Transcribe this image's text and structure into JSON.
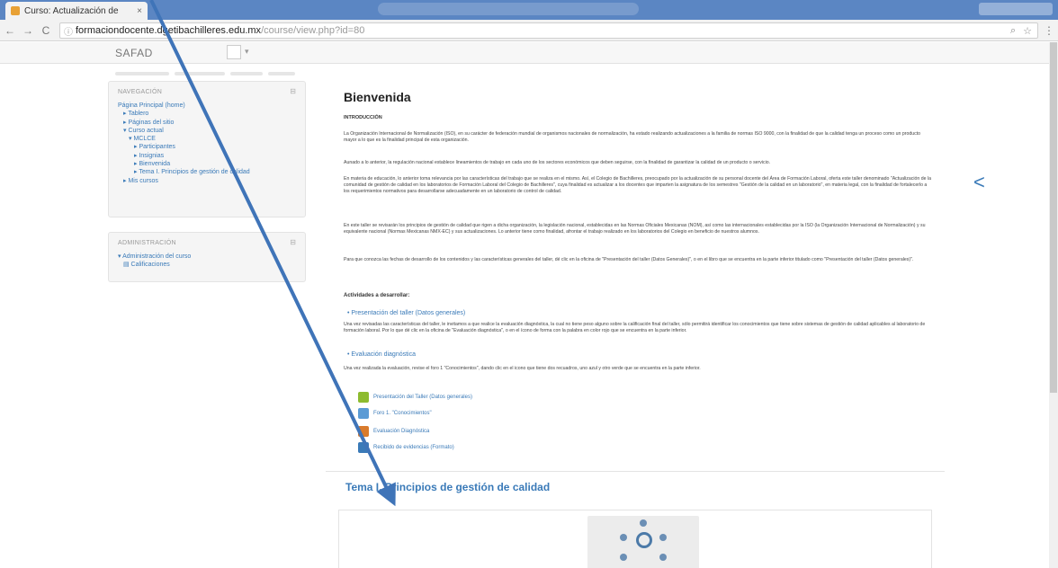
{
  "browser": {
    "tab_title": "Curso: Actualización de",
    "tab_close": "×",
    "url_host": "formaciondocente.dgetibachilleres.edu.mx",
    "url_path": "/course/view.php?id=80",
    "back": "←",
    "forward": "→",
    "reload": "C",
    "menu": "⋮"
  },
  "moodle": {
    "brand": "SAFAD",
    "user": "",
    "user_caret": "▾"
  },
  "nav_block": {
    "title": "NAVEGACIÓN",
    "items": [
      {
        "label": "Página Principal (home)",
        "level": 0
      },
      {
        "label": "▸ Tablero",
        "level": 1
      },
      {
        "label": "▸ Páginas del sitio",
        "level": 1
      },
      {
        "label": "▾ Curso actual",
        "level": 1
      },
      {
        "label": "▾ MCLCE",
        "level": 2
      },
      {
        "label": "▸ Participantes",
        "level": 3
      },
      {
        "label": "▸ Insignias",
        "level": 3
      },
      {
        "label": "▸ Bienvenida",
        "level": 3
      },
      {
        "label": "▸ Tema I. Principios de gestión de calidad",
        "level": 3
      },
      {
        "label": "▸ Mis cursos",
        "level": 1
      }
    ]
  },
  "admin_block": {
    "title": "ADMINISTRACIÓN",
    "items": [
      {
        "label": "▾ Administración del curso"
      },
      {
        "label": "▤ Calificaciones"
      }
    ]
  },
  "main": {
    "title": "Bienvenida",
    "intro_heading": "INTRODUCCIÓN",
    "paragraphs": [
      "La Organización Internacional de Normalización (ISO), en su carácter de federación mundial de organismos nacionales de normalización, ha estado realizando actualizaciones a la familia de normas ISO 9000, con la finalidad de que la calidad tenga un proceso como un producto mayor a lo que es la finalidad principal de esta organización.",
      "Aunado a lo anterior, la regulación nacional establece lineamientos de trabajo en cada uno de los sectores económicos que deben seguirse, con la finalidad de garantizar la calidad de un producto o servicio.",
      "En materia de educación, lo anterior toma relevancia por las características del trabajo que se realiza en el mismo. Así, el Colegio de Bachilleres, preocupado por la actualización de su personal docente del Área de Formación Laboral, oferta este taller denominado \"Actualización de la comunidad de gestión de calidad en los laboratorios de Formación Laboral del Colegio de Bachilleres\", cuya finalidad es actualizar a los docentes que imparten la asignatura de los semestres \"Gestión de la calidad en un laboratorio\", en materia legal, con la finalidad de fortalecerlo a los requerimientos normativos para desarrollarse adecuadamente en un laboratorio de control de calidad.",
      "En este taller se revisarán los principios de gestión de calidad que rigen a dicha organización, la legislación nacional, establecidas en las Normas Oficiales Mexicanas (NOM), así como las internacionales establecidas por la ISO (la Organización Internacional de Normalización) y su equivalente nacional (Normas Mexicanas NMX-EC) y sus actualizaciones. Lo anterior tiene como finalidad, afrontar el trabajo realizado en los laboratorios del Colegio en beneficio de nuestros alumnos.",
      "Para que conozca las fechas de desarrollo de los contenidos y las características generales del taller, dé clic en la oficina de \"Presentación del taller (Datos Generales)\", o en el libro que se encuentra en la parte inferior titulado como \"Presentación del taller (Datos generales)\"."
    ],
    "activities_heading": "Actividades a desarrollar:",
    "bullet1_title": "Presentación del taller (Datos generales)",
    "bullet1_text": "Una vez revisadas las características del taller, le invitamos a que realice la evaluación diagnóstica, la cual no tiene peso alguno sobre la calificación final del taller, sólo permitirá identificar los conocimientos que tiene sobre sistemas de gestión de calidad aplicables al laboratorio de formación laboral. Por lo que dé clic en la oficina de \"Evaluación diagnóstica\", o en el ícono de forma con la palabra en color rojo que se encuentra en la parte inferior.",
    "bullet2_title": "Evaluación diagnóstica",
    "bullet2_text": "Una vez realizada la evaluación, revise el foro 1 \"Conocimientos\", dando clic en el icono que tiene dos recuadros, uno azul y otro verde que se encuentra en la parte inferior.",
    "resources": [
      {
        "label": "Presentación del Taller (Datos generales)",
        "color": "#8dbb2f"
      },
      {
        "label": "Foro 1. \"Conocimientos\"",
        "color": "#5b9bd5"
      },
      {
        "label": "Evaluación Diagnóstica",
        "color": "#d97b2c"
      },
      {
        "label": "Recibido de evidencias (Formato)",
        "color": "#3a7ab8"
      }
    ]
  },
  "section2": {
    "title": "Tema I. Principios de gestión de calidad"
  },
  "side_arrow": "<",
  "colors": {
    "tabstrip": "#5b86c3",
    "link": "#3a7ab8",
    "arrow": "#3f74b8"
  }
}
